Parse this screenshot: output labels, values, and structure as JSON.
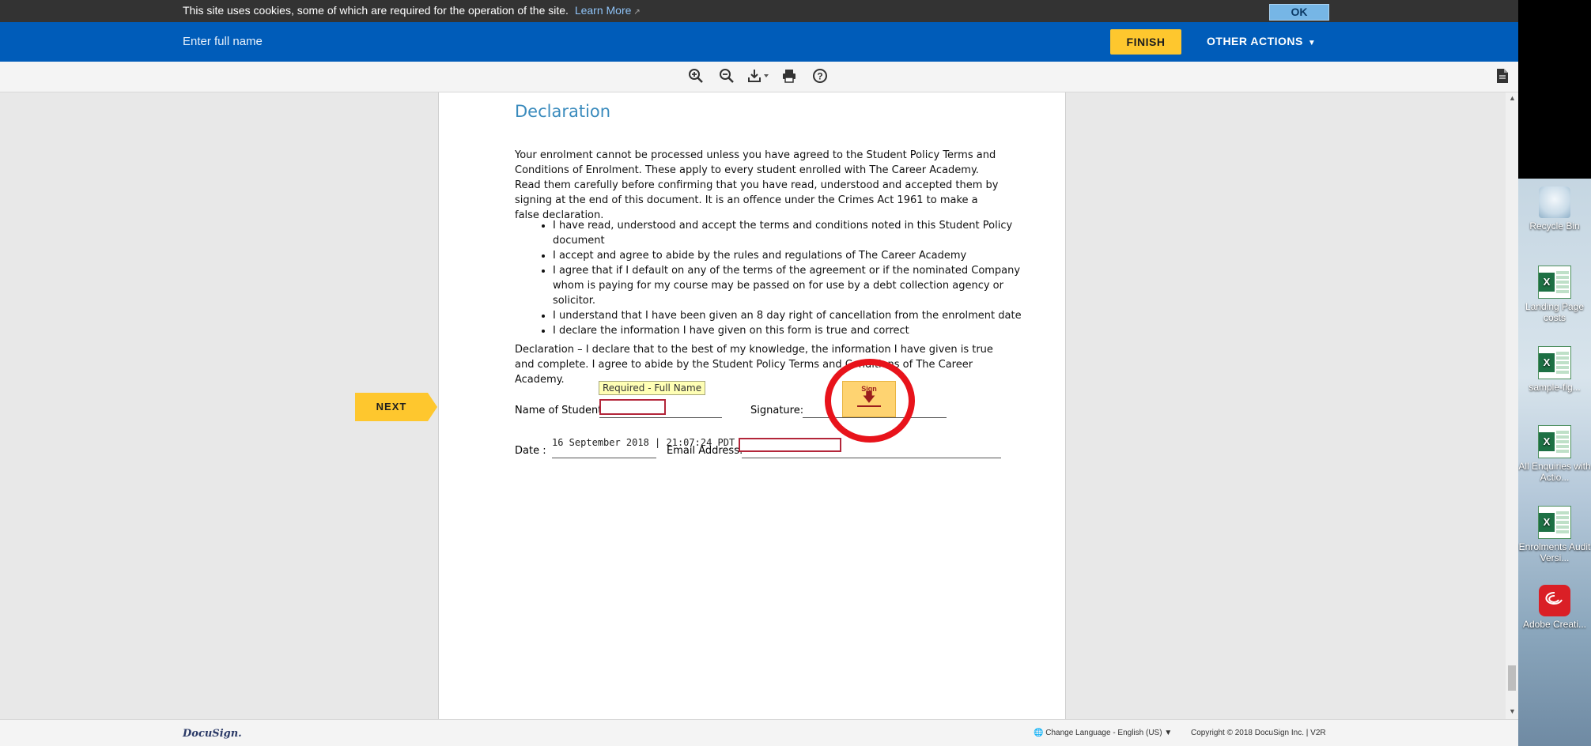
{
  "cookie_bar": {
    "message": "This site uses cookies, some of which are required for the operation of the site.",
    "learn_more": "Learn More",
    "ok_label": "OK"
  },
  "header": {
    "name_prompt": "Enter full name",
    "finish_label": "FINISH",
    "other_actions_label": "OTHER ACTIONS"
  },
  "toolbar": {
    "icons": [
      "zoom-in-icon",
      "zoom-out-icon",
      "download-icon",
      "print-icon",
      "help-icon"
    ]
  },
  "document": {
    "title": "Declaration",
    "intro": "Your enrolment cannot be processed unless you have agreed to the Student Policy Terms and Conditions of Enrolment. These apply to every student enrolled with The Career Academy. Read them carefully before confirming that you have read, understood and accepted them by signing at the end of this document. It is an offence under the Crimes Act 1961 to make a false declaration.",
    "bullets": [
      "I have read, understood and accept the terms and conditions noted in this Student Policy document",
      "I accept and agree to abide by the rules and regulations of The Career Academy",
      "I agree that if I default on any of the terms of the agreement or if the nominated Company whom is paying for my course may be passed on for use by a debt collection agency or solicitor.",
      "I understand that I have been given an 8 day right of cancellation from the enrolment date",
      "I declare the information I have given on this form is true and correct"
    ],
    "declaration": "Declaration – I declare that to the best of my knowledge, the information I have given is true and complete. I agree to abide by the Student Policy Terms and Conditions of The Career Academy.",
    "required_tip": "Required - Full Name",
    "name_label": "Name of Student:",
    "signature_label": "Signature:",
    "sign_tab_label": "Sign",
    "date_label": "Date :",
    "date_value": "16 September 2018 | 21:07:24 PDT",
    "email_label": "Email Address:"
  },
  "next_label": "NEXT",
  "footer": {
    "logo": "DocuSign.",
    "language": "Change Language - English (US)",
    "copyright": "Copyright © 2018 DocuSign Inc. | V2R"
  },
  "desktop": {
    "icons": [
      {
        "label": "Recycle Bin",
        "icon": "recycle-bin-icon"
      },
      {
        "label": "Landing Page costs",
        "icon": "excel-icon"
      },
      {
        "label": "sample-fig...",
        "icon": "excel-icon"
      },
      {
        "label": "All Enquiries with Actio...",
        "icon": "excel-icon"
      },
      {
        "label": "Enrolments Audit Versi...",
        "icon": "excel-icon"
      },
      {
        "label": "Adobe Creati...",
        "icon": "adobe-cc-icon"
      }
    ]
  },
  "colors": {
    "header_blue": "#005cb9",
    "accent_yellow": "#fec72e",
    "field_red": "#b3263a",
    "circle_red": "#e8131b",
    "title_teal": "#3a8bbd"
  }
}
